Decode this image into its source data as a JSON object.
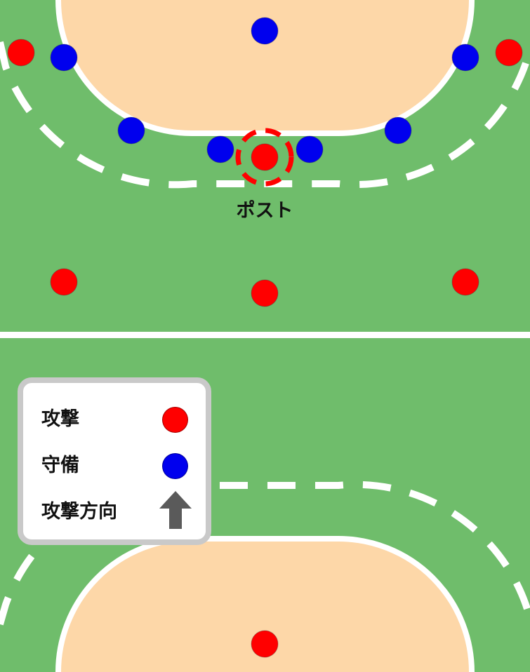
{
  "colors": {
    "court": "#6fbd6b",
    "goal_area": "#fdd7a8",
    "lines": "#ffffff",
    "attack": "#ff0000",
    "defense": "#0000ee",
    "arrow": "#5a5a5a"
  },
  "post_label": "ポスト",
  "legend": {
    "attack_label": "攻撃",
    "defense_label": "守備",
    "direction_label": "攻撃方向",
    "attack_icon": "red-circle",
    "defense_icon": "blue-circle",
    "direction_icon": "up-arrow"
  }
}
